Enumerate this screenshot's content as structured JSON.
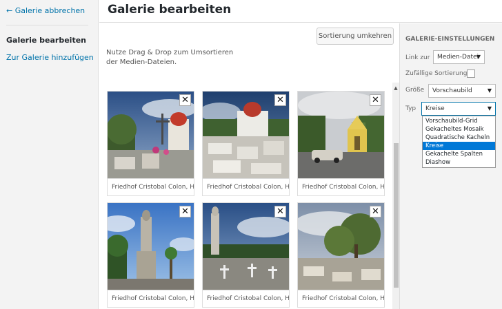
{
  "left_menu": {
    "cancel_label": "← Galerie abbrechen",
    "active_item": "Galerie bearbeiten",
    "add_link": "Zur Galerie hinzufügen"
  },
  "header": {
    "title": "Galerie bearbeiten"
  },
  "main": {
    "reverse_button": "Sortierung umkehren",
    "instructions": "Nutze Drag & Drop zum Umsortieren der Medien-Dateien.",
    "close_symbol": "✕",
    "tiles": [
      {
        "caption": "Friedhof Cristobal Colon, Havanna"
      },
      {
        "caption": "Friedhof Cristobal Colon, Havanna"
      },
      {
        "caption": "Friedhof Cristobal Colon, Havanna"
      },
      {
        "caption": "Friedhof Cristobal Colon, Havanna"
      },
      {
        "caption": "Friedhof Cristobal Colon, Havanna"
      },
      {
        "caption": "Friedhof Cristobal Colon, Havanna"
      }
    ]
  },
  "sidebar": {
    "heading": "GALERIE-EINSTELLUNGEN",
    "link_label": "Link zur",
    "link_value": "Medien-Datei",
    "random_label": "Zufällige Sortierung",
    "size_label": "Größe",
    "size_value": "Vorschaubild",
    "type_label": "Typ",
    "type_value": "Kreise",
    "type_options": [
      "Vorschaubild-Grid",
      "Gekacheltes Mosaik",
      "Quadratische Kacheln",
      "Kreise",
      "Gekachelte Spalten",
      "Diashow"
    ],
    "selected_option": "Kreise"
  },
  "icons": {
    "dropdown_arrow": "▼",
    "scroll_up": "▲"
  },
  "colors": {
    "link": "#0073aa",
    "selection": "#0078d7"
  }
}
